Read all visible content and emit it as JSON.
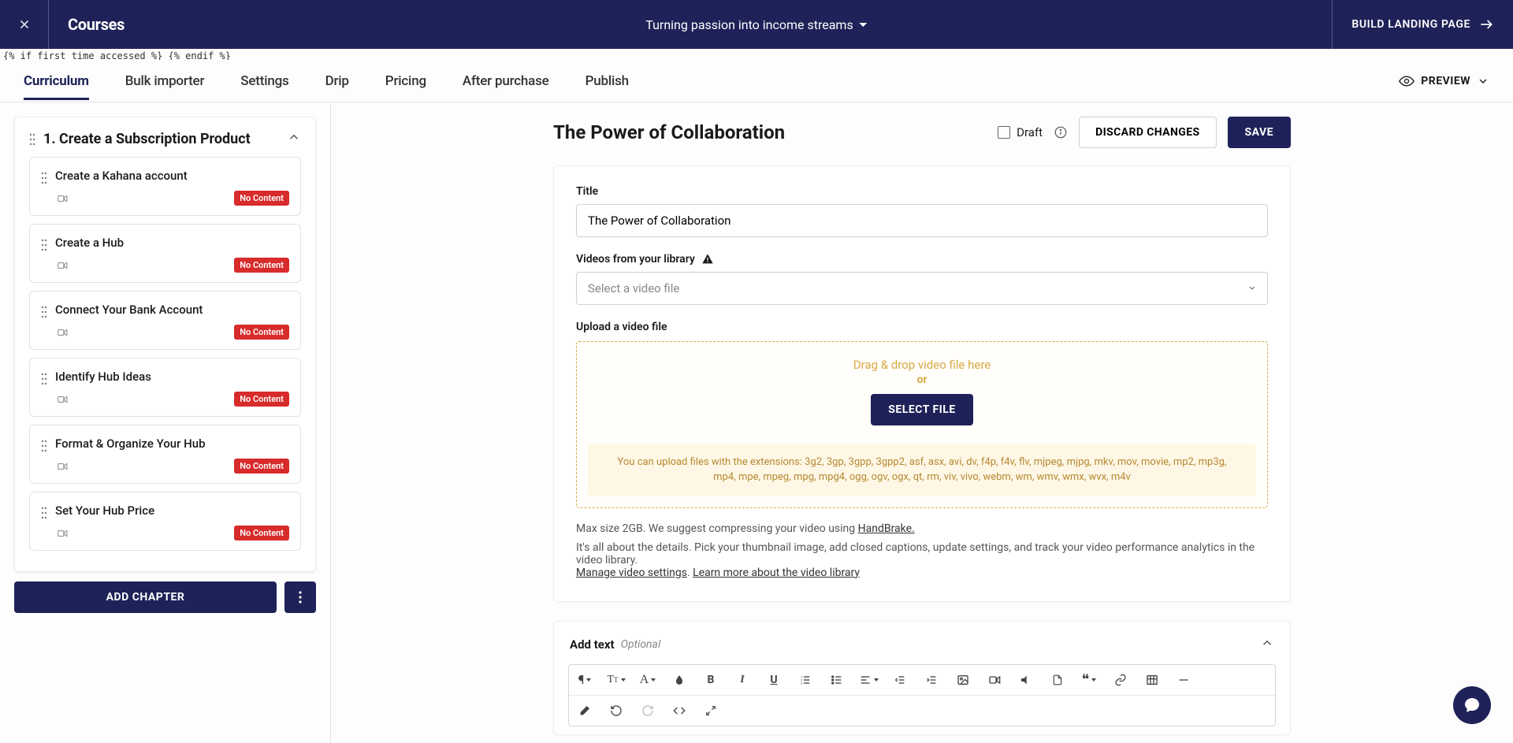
{
  "topbar": {
    "title": "Courses",
    "course_name": "Turning passion into income streams",
    "build_landing_page": "BUILD LANDING PAGE"
  },
  "template_stray": "{% if first_time_accessed %}  {% endif %}",
  "tabs": {
    "items": [
      "Curriculum",
      "Bulk importer",
      "Settings",
      "Drip",
      "Pricing",
      "After purchase",
      "Publish"
    ],
    "active_index": 0,
    "preview_label": "PREVIEW"
  },
  "sidebar": {
    "chapter_title": "1. Create a Subscription Product",
    "lessons": [
      {
        "title": "Create a Kahana account",
        "badge": "No Content"
      },
      {
        "title": "Create a Hub",
        "badge": "No Content"
      },
      {
        "title": "Connect Your Bank Account",
        "badge": "No Content"
      },
      {
        "title": "Identify Hub Ideas",
        "badge": "No Content"
      },
      {
        "title": "Format & Organize Your Hub",
        "badge": "No Content"
      },
      {
        "title": "Set Your Hub Price",
        "badge": "No Content"
      }
    ],
    "add_chapter_label": "ADD CHAPTER"
  },
  "editor": {
    "page_title": "The Power of Collaboration",
    "draft_label": "Draft",
    "discard_label": "DISCARD CHANGES",
    "save_label": "SAVE",
    "title_field_label": "Title",
    "title_value": "The Power of Collaboration",
    "library_label": "Videos from your library",
    "library_placeholder": "Select a video file",
    "upload_label": "Upload a video file",
    "dropzone_main": "Drag & drop video file here",
    "dropzone_or": "or",
    "select_file_label": "SELECT FILE",
    "ext_info": "You can upload files with the extensions: 3g2, 3gp, 3gpp, 3gpp2, asf, asx, avi, dv, f4p, f4v, flv, mjpeg, mjpg, mkv, mov, movie, mp2, mp3g, mp4, mpe, mpeg, mpg, mpg4, ogg, ogv, ogx, qt, rm, viv, vivo, webm, wm, wmv, wmx, wvx, m4v",
    "hint_size_prefix": "Max size 2GB. We suggest compressing your video using ",
    "hint_size_link": "HandBrake.",
    "hint_details": "It's all about the details. Pick your thumbnail image, add closed captions, update settings, and track your video performance analytics in the video library.",
    "hint_manage_link": "Manage video settings",
    "hint_learn_link": "Learn more about the video library",
    "addtext_label": "Add text",
    "addtext_optional": "Optional"
  }
}
